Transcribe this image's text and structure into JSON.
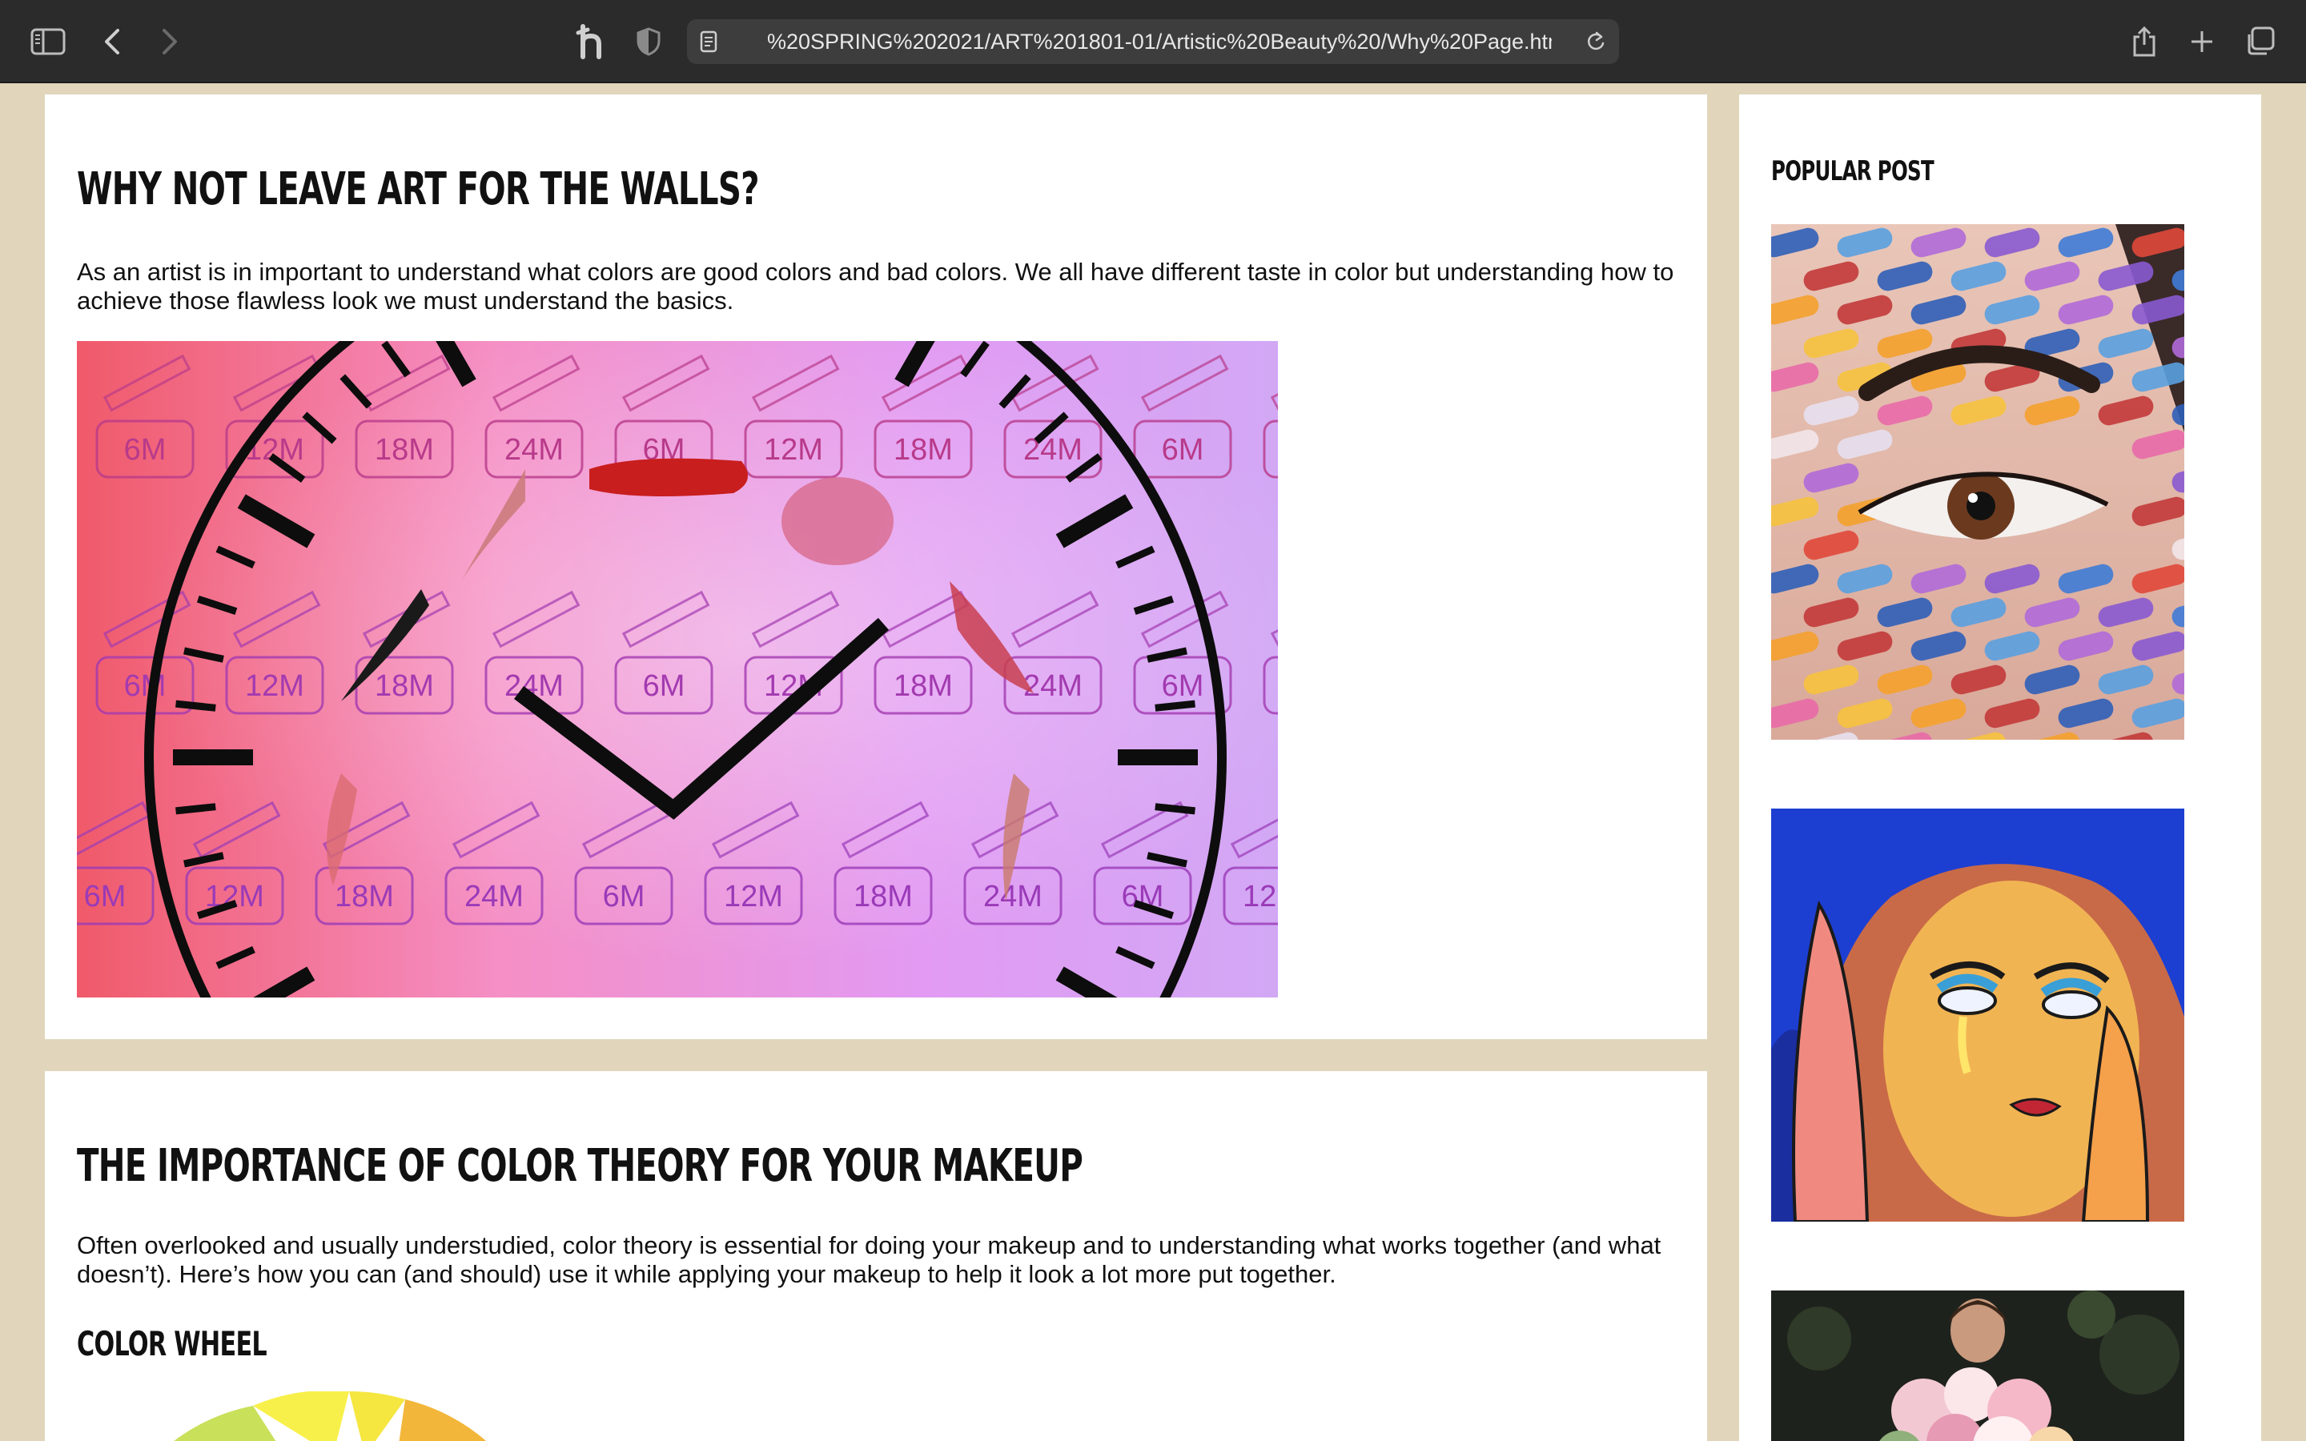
{
  "browser": {
    "url": "%20SPRING%202021/ART%201801-01/Artistic%20Beauty%20/Why%20Page.html",
    "icons": [
      "sidebar-icon",
      "back-icon",
      "forward-icon",
      "honey-extension-icon",
      "privacy-shield-icon",
      "page-icon",
      "reload-icon",
      "share-icon",
      "new-tab-icon",
      "tab-overview-icon"
    ]
  },
  "article1": {
    "title": "Why not leave art for the walls?",
    "body": "As an artist is in important to understand what colors are good colors and bad colors. We all have different taste in color but understanding how to achieve those flawless look we must understand the basics.",
    "clock_labels": [
      "6M",
      "12M",
      "18M",
      "24M"
    ]
  },
  "article2": {
    "title": "The importance of color theory for your makeup",
    "body": "Often overlooked and usually understudied, color theory is essential for doing your makeup and to understanding what works together (and what doesn’t). Here’s how you can (and should) use it while applying your makeup to help it look a lot more put together.",
    "subheading": "Color Wheel"
  },
  "sidebar": {
    "title": "Popular Post"
  },
  "colors": {
    "page_bg": "#e1d6bb",
    "toolbar_bg": "#2b2b2b",
    "card_bg": "#ffffff"
  }
}
